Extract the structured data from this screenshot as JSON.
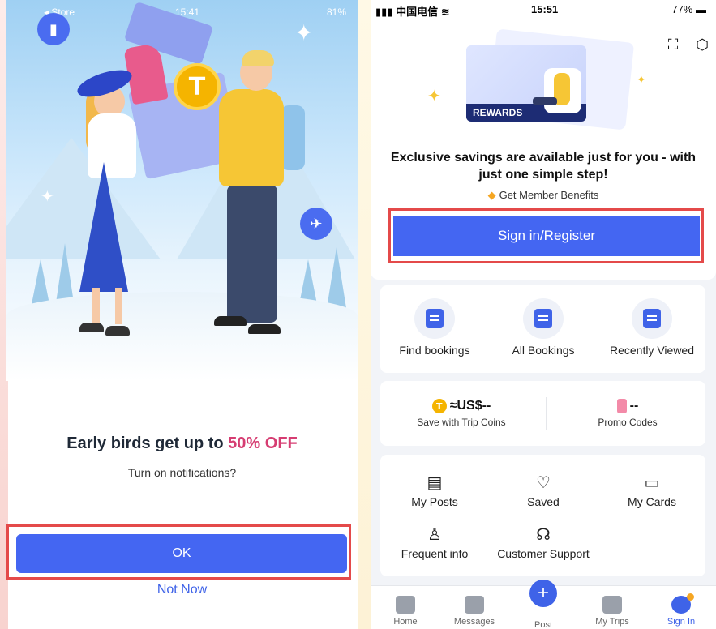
{
  "left_screen": {
    "status": {
      "carrier": "◂ Store",
      "time": "15:41",
      "battery": "81%"
    },
    "promo": {
      "title_prefix": "Early birds get up to ",
      "title_accent": "50% OFF",
      "subtitle": "Turn on notifications?"
    },
    "buttons": {
      "ok": "OK",
      "not_now": "Not Now"
    },
    "coin_glyph": "T"
  },
  "right_screen": {
    "status": {
      "carrier": "中国电信",
      "time": "15:51",
      "battery": "77%"
    },
    "rewards_card_label": "REWARDS",
    "headline": "Exclusive savings are available just for you - with just one simple step!",
    "benefits": "Get Member Benefits",
    "signin_button": "Sign in/Register",
    "quick_actions": [
      {
        "label": "Find bookings",
        "icon": "find-bookings-icon"
      },
      {
        "label": "All Bookings",
        "icon": "all-bookings-icon"
      },
      {
        "label": "Recently Viewed",
        "icon": "recently-viewed-icon"
      }
    ],
    "wallet": {
      "coins_value": "≈US$--",
      "coins_label": "Save with Trip Coins",
      "coins_glyph": "T",
      "promo_value": "--",
      "promo_label": "Promo Codes"
    },
    "menu": [
      {
        "label": "My Posts",
        "icon": "posts-icon"
      },
      {
        "label": "Saved",
        "icon": "heart-icon"
      },
      {
        "label": "My Cards",
        "icon": "card-icon"
      },
      {
        "label": "Frequent info",
        "icon": "person-icon"
      },
      {
        "label": "Customer Support",
        "icon": "headset-icon"
      }
    ],
    "tabs": [
      {
        "label": "Home"
      },
      {
        "label": "Messages"
      },
      {
        "label": "Post"
      },
      {
        "label": "My Trips"
      },
      {
        "label": "Sign In"
      }
    ]
  },
  "colors": {
    "primary": "#4466f2",
    "accent_pink": "#d63d72",
    "highlight_red": "#e44a4a",
    "coin_gold": "#f5b400"
  }
}
